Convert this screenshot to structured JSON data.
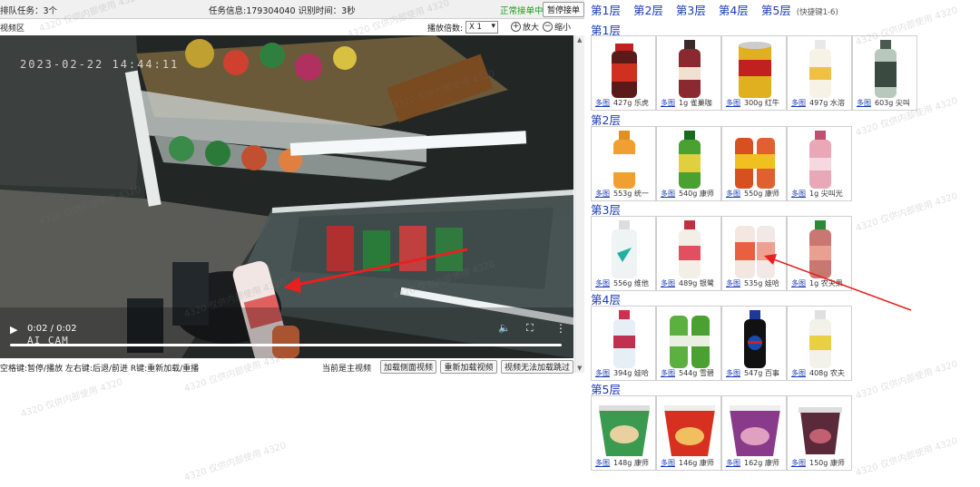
{
  "topbar": {
    "queue": "排队任务：3个",
    "task_info": "任务信息:179304040 识别时间：3秒",
    "status": "正常接单中",
    "pause_button": "暂停接单"
  },
  "videobar": {
    "label": "视频区",
    "rate_label": "播放倍数:",
    "rate_value": "X 1",
    "zoom_in": "放大",
    "zoom_out": "缩小"
  },
  "video": {
    "timestamp": "2023-02-22 14:44:11",
    "camera": "AI CAM",
    "time": "0:02 / 0:02",
    "progress": 1.0
  },
  "bottombar": {
    "hotkeys": "空格键:暂停/播放 左右键:后退/前进 R键:重新加载/重播",
    "main_video": "当前是主视频",
    "btn_side": "加载侧面视频",
    "btn_reload": "重新加载视频",
    "btn_skip": "视频无法加载跳过"
  },
  "layers": {
    "tabs": [
      "第1层",
      "第2层",
      "第3层",
      "第4层",
      "第5层"
    ],
    "hint": "(快捷键1-6)",
    "sections": [
      {
        "title": "第1层",
        "items": [
          {
            "multi": "多图",
            "label": "427g 乐虎"
          },
          {
            "multi": "多图",
            "label": "1g 雀巢咖"
          },
          {
            "multi": "多图",
            "label": "300g 红牛"
          },
          {
            "multi": "多图",
            "label": "497g 水溶"
          },
          {
            "multi": "多图",
            "label": "603g 尖叫"
          }
        ]
      },
      {
        "title": "第2层",
        "items": [
          {
            "multi": "多图",
            "label": "553g 统一"
          },
          {
            "multi": "多图",
            "label": "540g 康师"
          },
          {
            "multi": "多图",
            "label": "550g 康师"
          },
          {
            "multi": "多图",
            "label": "1g 尖叫光"
          }
        ]
      },
      {
        "title": "第3层",
        "items": [
          {
            "multi": "多图",
            "label": "556g 维他"
          },
          {
            "multi": "多图",
            "label": "489g 银鹭"
          },
          {
            "multi": "多图",
            "label": "535g 娃哈"
          },
          {
            "multi": "多图",
            "label": "1g 农夫果"
          }
        ]
      },
      {
        "title": "第4层",
        "items": [
          {
            "multi": "多图",
            "label": "394g 娃哈"
          },
          {
            "multi": "多图",
            "label": "544g 雪碧"
          },
          {
            "multi": "多图",
            "label": "547g 百事"
          },
          {
            "multi": "多图",
            "label": "408g 农夫"
          }
        ]
      },
      {
        "title": "第5层",
        "items": [
          {
            "multi": "多图",
            "label": "148g 康师"
          },
          {
            "multi": "多图",
            "label": "146g 康师"
          },
          {
            "multi": "多图",
            "label": "162g 康师"
          },
          {
            "multi": "多图",
            "label": "150g 康师"
          }
        ]
      }
    ]
  },
  "watermark": "4320 仅供内部使用 4320",
  "colors": {
    "link_blue": "#1a3bb5",
    "status_green": "#1a9c1a",
    "arrow_red": "#e8201f"
  }
}
